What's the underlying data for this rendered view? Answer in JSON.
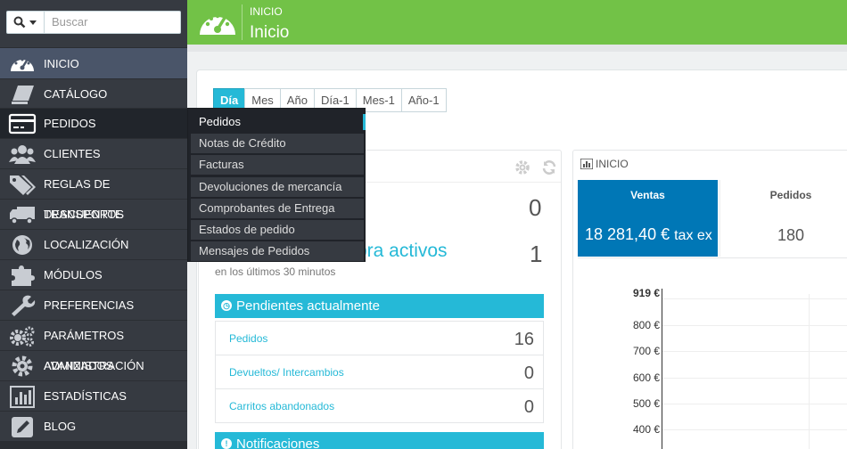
{
  "search": {
    "placeholder": "Buscar"
  },
  "nav": [
    {
      "label": "INICIO",
      "icon": "dashboard-icon"
    },
    {
      "label": "CATÁLOGO",
      "icon": "book-icon"
    },
    {
      "label": "PEDIDOS",
      "icon": "credit-card-icon"
    },
    {
      "label": "CLIENTES",
      "icon": "users-icon"
    },
    {
      "label": "REGLAS DE DESCUENTOS",
      "icon": "tags-icon"
    },
    {
      "label": "TRANSPORTE",
      "icon": "truck-icon"
    },
    {
      "label": "LOCALIZACIÓN",
      "icon": "globe-icon"
    },
    {
      "label": "MÓDULOS",
      "icon": "puzzle-icon"
    },
    {
      "label": "PREFERENCIAS",
      "icon": "wrench-icon"
    },
    {
      "label": "PARÁMETROS AVANZADOS",
      "icon": "cogs-icon"
    },
    {
      "label": "ADMINISTRACIÓN",
      "icon": "gear-icon"
    },
    {
      "label": "ESTADÍSTICAS",
      "icon": "bar-chart-icon"
    },
    {
      "label": "BLOG",
      "icon": "pencil-icon"
    }
  ],
  "submenu": [
    "Pedidos",
    "Notas de Crédito",
    "Facturas",
    "Devoluciones de mercancía",
    "Comprobantes de Entrega",
    "Estados de pedido",
    "Mensajes de Pedidos"
  ],
  "header": {
    "breadcrumb": "INICIO",
    "title": "Inicio"
  },
  "periods": [
    "Día",
    "Mes",
    "Año",
    "Día-1",
    "Mes-1",
    "Año-1"
  ],
  "activity": {
    "value_top": "0",
    "carts_label": "pra activos",
    "carts_value": "1",
    "carts_sub": "en los últimos 30 minutos",
    "pending_title": "Pendientes actualmente",
    "pending": [
      {
        "label": "Pedidos",
        "value": "16"
      },
      {
        "label": "Devueltos/ Intercambios",
        "value": "0"
      },
      {
        "label": "Carritos abandonados",
        "value": "0"
      }
    ],
    "notif_title": "Notificaciones"
  },
  "dashboard": {
    "title": "INICIO",
    "ventas_label": "Ventas",
    "ventas_value": "18 281,40 €",
    "ventas_suffix": "tax ex",
    "pedidos_label": "Pedidos",
    "pedidos_value": "180",
    "y_ticks": [
      "919 €",
      "800 €",
      "700 €",
      "600 €",
      "500 €",
      "400 €"
    ]
  },
  "colors": {
    "accent": "#25b9d7",
    "header": "#72c247",
    "sidebar": "#363a41",
    "kpi": "#0077b6"
  }
}
